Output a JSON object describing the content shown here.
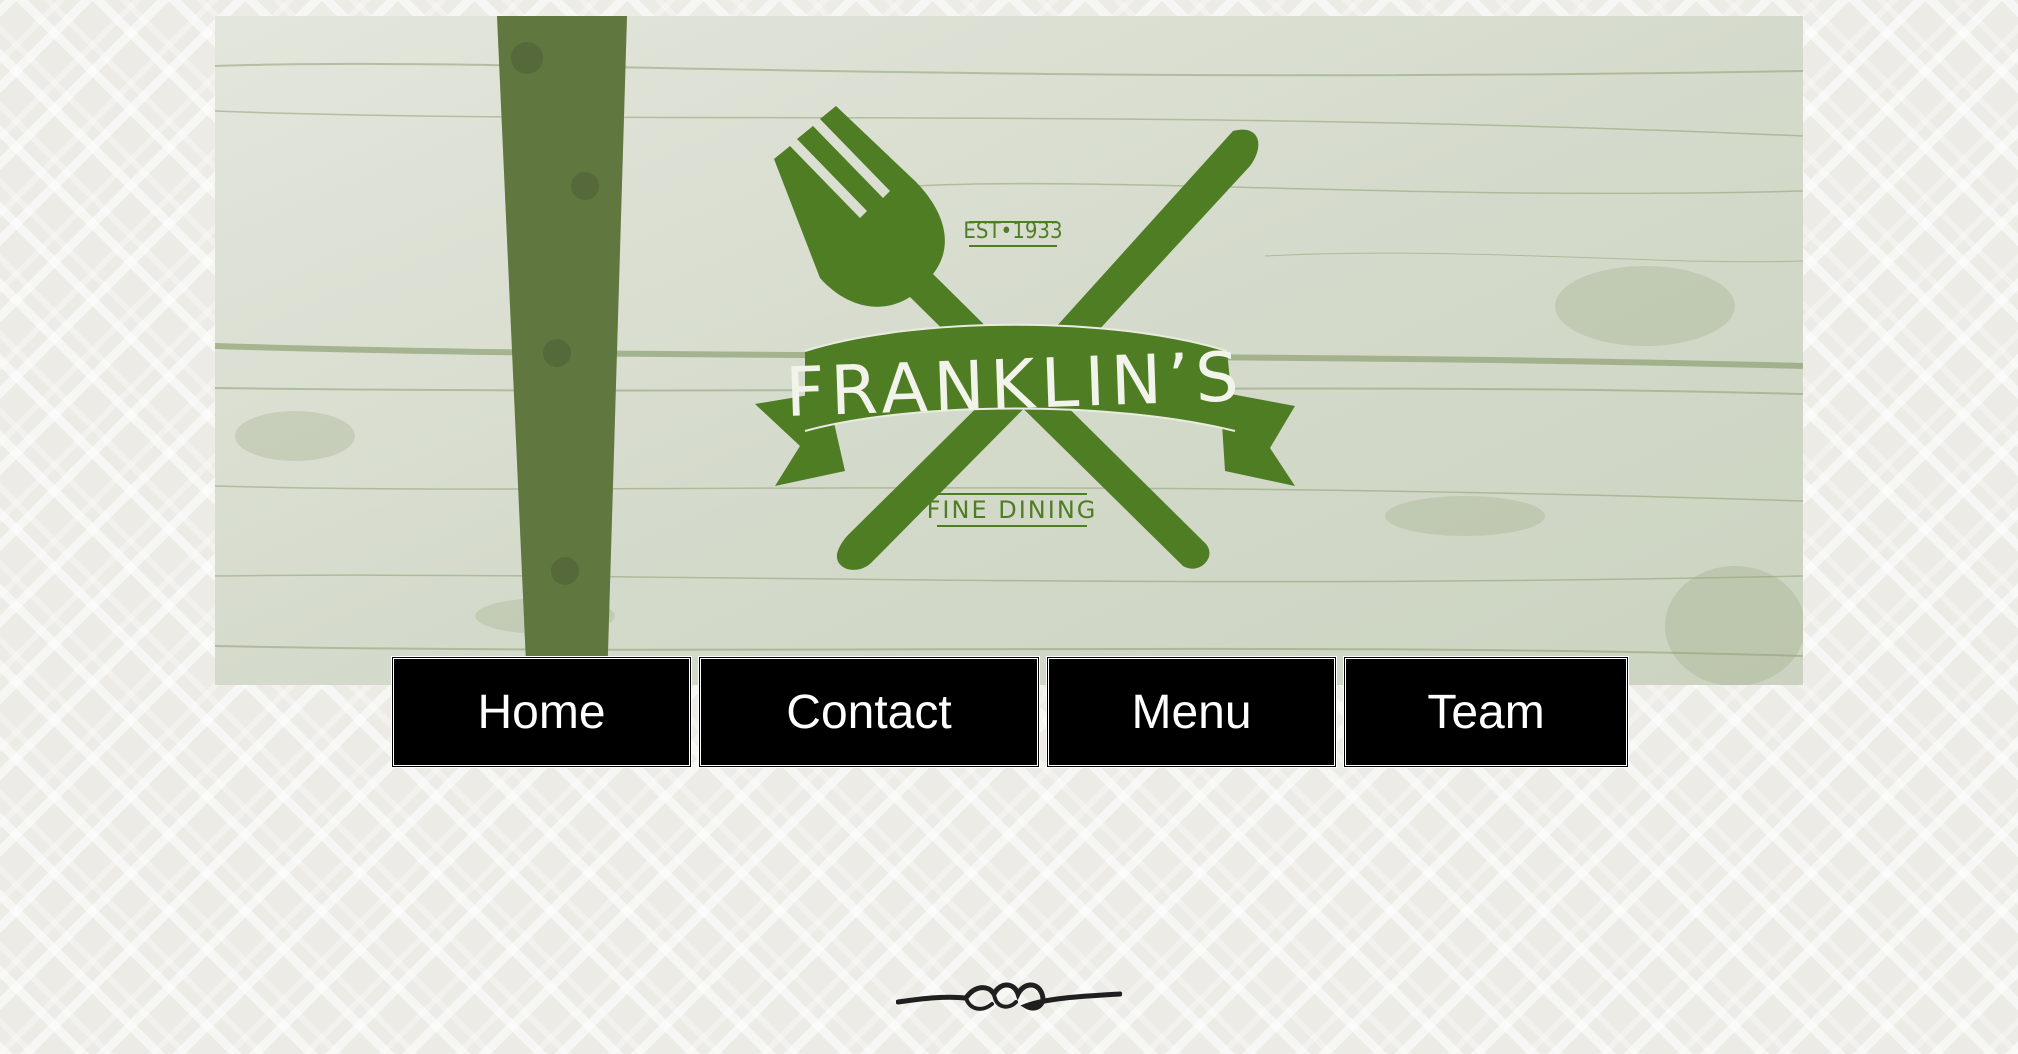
{
  "hero": {
    "logo_name": "FRANKLIN’S",
    "logo_est": "EST•1933",
    "logo_tagline": "FINE DINING",
    "colors": {
      "green": "#4f7d24",
      "wood": "#d8ddd0"
    }
  },
  "nav": {
    "items": [
      {
        "label": "Home"
      },
      {
        "label": "Contact"
      },
      {
        "label": "Menu"
      },
      {
        "label": "Team"
      }
    ]
  },
  "icons": {
    "hero": [
      "fork-icon",
      "knife-icon",
      "banner-ribbon-icon"
    ],
    "divider": "flourish-divider-icon"
  }
}
